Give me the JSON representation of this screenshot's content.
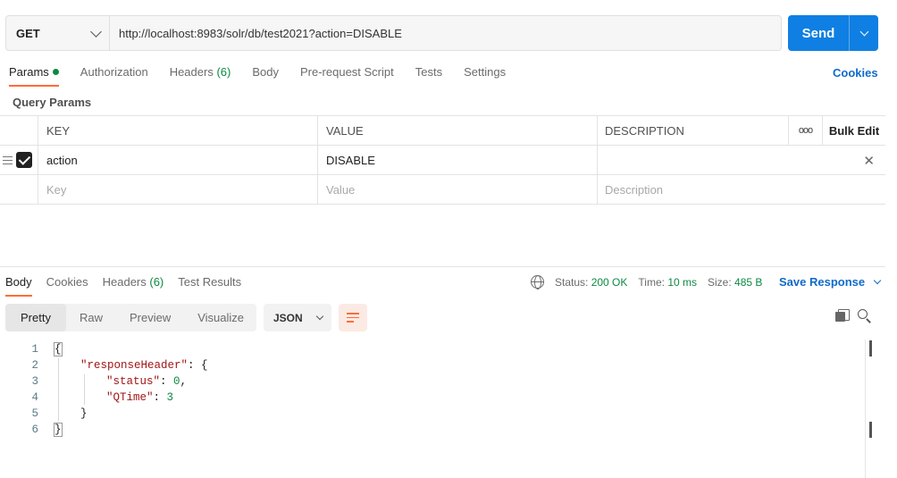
{
  "request": {
    "method": "GET",
    "url": "http://localhost:8983/solr/db/test2021?action=DISABLE",
    "send_label": "Send"
  },
  "request_tabs": [
    {
      "label": "Params",
      "active": true,
      "dot": true
    },
    {
      "label": "Authorization"
    },
    {
      "label": "Headers",
      "count": "(6)"
    },
    {
      "label": "Body"
    },
    {
      "label": "Pre-request Script"
    },
    {
      "label": "Tests"
    },
    {
      "label": "Settings"
    }
  ],
  "cookies_label": "Cookies",
  "query_params": {
    "title": "Query Params",
    "headers": {
      "key": "KEY",
      "value": "VALUE",
      "description": "DESCRIPTION",
      "bulk_edit": "Bulk Edit"
    },
    "rows": [
      {
        "key": "action",
        "value": "DISABLE",
        "description": "",
        "checked": true
      }
    ],
    "placeholders": {
      "key": "Key",
      "value": "Value",
      "description": "Description"
    }
  },
  "response_tabs": [
    {
      "label": "Body",
      "active": true
    },
    {
      "label": "Cookies"
    },
    {
      "label": "Headers",
      "count": "(6)"
    },
    {
      "label": "Test Results"
    }
  ],
  "response_status": {
    "status_label": "Status:",
    "status_value": "200 OK",
    "time_label": "Time:",
    "time_value": "10 ms",
    "size_label": "Size:",
    "size_value": "485 B",
    "save_label": "Save Response"
  },
  "format_tabs": [
    "Pretty",
    "Raw",
    "Preview",
    "Visualize"
  ],
  "format_select": "JSON",
  "code_lines": [
    {
      "n": "1",
      "t": "{"
    },
    {
      "n": "2",
      "k": "\"responseHeader\"",
      "t": ": {"
    },
    {
      "n": "3",
      "k": "\"status\"",
      "t": ": ",
      "v": "0",
      "tail": ","
    },
    {
      "n": "4",
      "k": "\"QTime\"",
      "t": ": ",
      "v": "3"
    },
    {
      "n": "5",
      "t": "}"
    },
    {
      "n": "6",
      "t": "}"
    }
  ],
  "colors": {
    "accent": "#ff6c37",
    "primary": "#0f7fe3",
    "link": "#0f6ac9",
    "success": "#0b8a43"
  }
}
